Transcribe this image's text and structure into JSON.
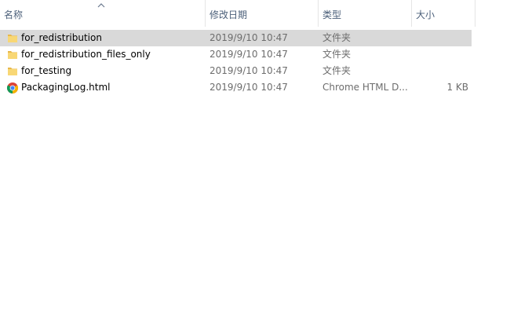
{
  "columns": {
    "name": "名称",
    "date": "修改日期",
    "type": "类型",
    "size": "大小"
  },
  "files": [
    {
      "name": "for_redistribution",
      "date": "2019/9/10 10:47",
      "type": "文件夹",
      "size": "",
      "icon": "folder-icon",
      "selected": true
    },
    {
      "name": "for_redistribution_files_only",
      "date": "2019/9/10 10:47",
      "type": "文件夹",
      "size": "",
      "icon": "folder-icon",
      "selected": false
    },
    {
      "name": "for_testing",
      "date": "2019/9/10 10:47",
      "type": "文件夹",
      "size": "",
      "icon": "folder-icon",
      "selected": false
    },
    {
      "name": "PackagingLog.html",
      "date": "2019/9/10 10:47",
      "type": "Chrome HTML D...",
      "size": "1 KB",
      "icon": "chrome-icon",
      "selected": false
    }
  ],
  "colors": {
    "header_text": "#4c607a",
    "selected_row": "#d9d9d9",
    "folder": "#f8d775"
  }
}
